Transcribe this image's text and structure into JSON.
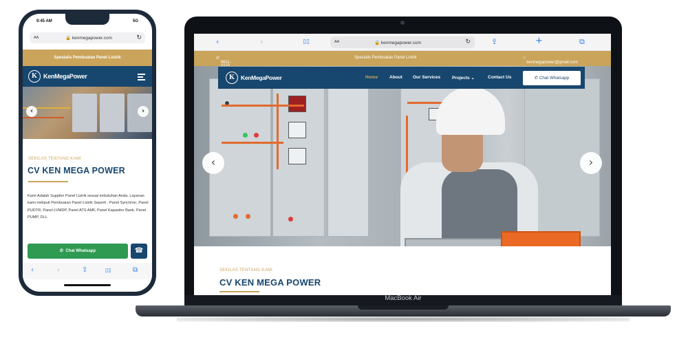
{
  "phone": {
    "status_time": "9:45 AM",
    "status_signal": "5G",
    "url_aa": "AA",
    "url": "kenmegapower.com",
    "topbar": "Spesialis Pembuatan Panel Listrik",
    "brand_logo": "K",
    "brand_name": "KenMegaPower",
    "hero_prev": "‹",
    "hero_next": "›",
    "kicker": "SEKILAS TENTANG KAMI",
    "title": "CV KEN MEGA POWER",
    "body": "Kami Adalah Supplier Panel Listrik sesuai kebutuhan Anda. Layanan kami meliputi Pembuatan Panel Listrik Seperti : Panel Synchron, Panel PUDTR, Panel LVMDP, Panel ATS AMF, Panel Kapasitor Bank, Panel PUMP, DLL",
    "whatsapp_button": "Chat Whatsapp",
    "call_icon": "☎",
    "toolbar": {
      "back": "‹",
      "forward": "›",
      "share": "⇪",
      "bookmarks": "▯▯",
      "tabs": "⧉"
    }
  },
  "laptop": {
    "browser": {
      "back": "‹",
      "forward": "›",
      "reader": "▯▯",
      "url_aa": "AA",
      "url": "kenmegapower.com",
      "reload": "↻",
      "share": "⇪",
      "new_tab": "+",
      "tabs": "⧉"
    },
    "topbar": {
      "phone": "0811-3229-94",
      "tagline": "Spesialis Pembuatan Panel Listrik",
      "email": "kenmegapower@gmail.com"
    },
    "brand_logo": "K",
    "brand_name": "KenMegaPower",
    "nav": {
      "home": "Home",
      "about": "About",
      "services": "Our Services",
      "projects": "Projects",
      "contact": "Contact Us",
      "whatsapp": "Chat Whatsapp"
    },
    "hero_prev": "‹",
    "hero_next": "›",
    "kicker": "SEKILAS TENTANG KAMI",
    "title": "CV KEN MEGA POWER",
    "model": "MacBook Air"
  },
  "colors": {
    "gold": "#c9a45a",
    "navy": "#17466e",
    "whatsapp_green": "#2e9a52"
  }
}
